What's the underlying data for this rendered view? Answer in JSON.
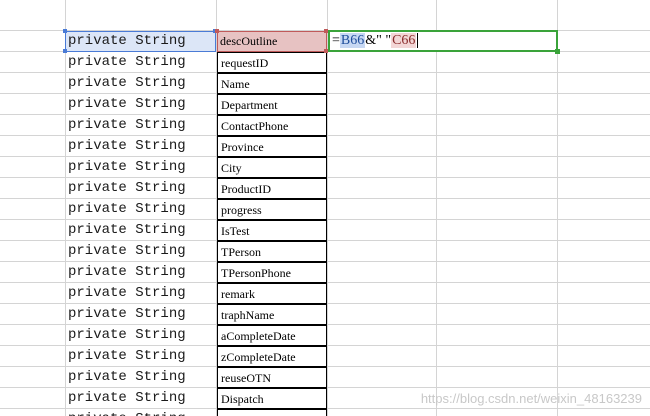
{
  "cells": {
    "b_value": "private String",
    "c_values": [
      "descOutline",
      "requestID",
      "Name",
      "Department",
      "ContactPhone",
      "Province",
      "City",
      "ProductID",
      "progress",
      "IsTest",
      "TPerson",
      "TPersonPhone",
      "remark",
      "traphName",
      "aCompleteDate",
      "zCompleteDate",
      "reuseOTN",
      "Dispatch",
      "dispatchContent"
    ]
  },
  "formula": {
    "eq": "=",
    "ref1": "B66",
    "op": "&\" \"",
    "ref2": "C66"
  },
  "watermark": "https://blog.csdn.net/weixin_48163239",
  "colors": {
    "active_green": "#3aa33a",
    "ref_blue": "#4a7bd6",
    "ref_red": "#c05a5a"
  }
}
